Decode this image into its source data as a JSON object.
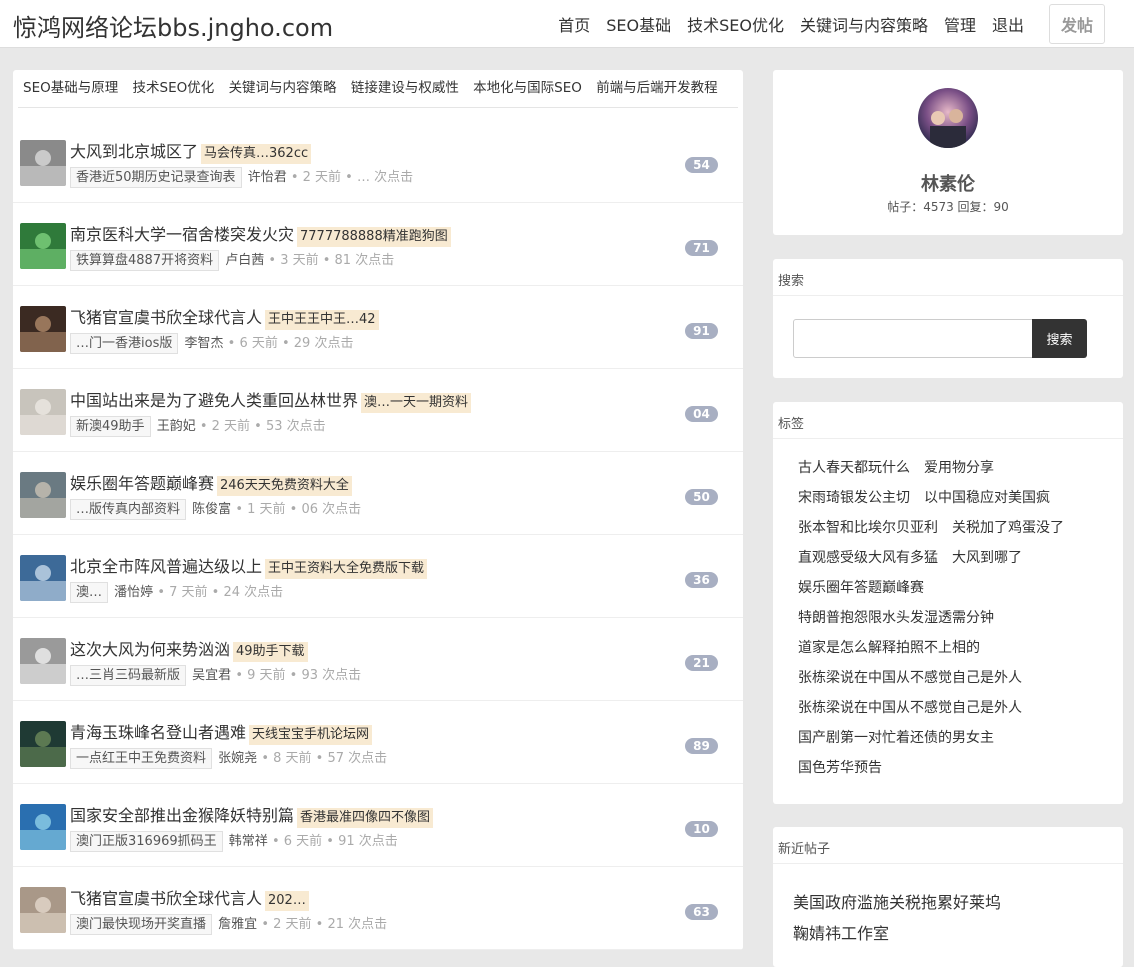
{
  "header": {
    "site_title": "惊鸿网络论坛bbs.jngho.com",
    "nav": [
      "首页",
      "SEO基础",
      "技术SEO优化",
      "关键词与内容策略",
      "管理",
      "退出"
    ],
    "post_button": "发帖"
  },
  "categories": [
    "SEO基础与原理",
    "技术SEO优化",
    "关键词与内容策略",
    "链接建设与权威性",
    "本地化与国际SEO",
    "前端与后端开发教程"
  ],
  "posts": [
    {
      "title": "大风到北京城区了",
      "highlight": "马会传真…362cc",
      "forum": "香港近50期历史记录查询表",
      "author": "许怡君",
      "meta": "• 2 天前 • … 次点击",
      "count": "54",
      "thumb_colors": [
        "#8a8a8a",
        "#d9d9d9"
      ]
    },
    {
      "title": "南京医科大学一宿舍楼突发火灾",
      "highlight": "7777788888精准跑狗图",
      "forum": "铁算算盘4887开将资料",
      "author": "卢白茜",
      "meta": "• 3 天前 • 81 次点击",
      "count": "71",
      "thumb_colors": [
        "#2f7a3a",
        "#7ed27e"
      ]
    },
    {
      "title": "飞猪官宣虞书欣全球代言人",
      "highlight": "王中王王中王…42",
      "forum": "…门一香港ios版",
      "author": "李智杰",
      "meta": "• 6 天前 • 29 次点击",
      "count": "91",
      "thumb_colors": [
        "#3b2a22",
        "#b08a6a"
      ]
    },
    {
      "title": "中国站出来是为了避免人类重回丛林世界",
      "highlight": "澳…一天一期资料",
      "forum": "新澳49助手",
      "author": "王韵妃",
      "meta": "• 2 天前 • 53 次点击",
      "count": "04",
      "thumb_colors": [
        "#c8c4bc",
        "#ece8e2"
      ]
    },
    {
      "title": "娱乐圈年答题巅峰赛",
      "highlight": "246天天免费资料大全",
      "forum": "…版传真内部资料",
      "author": "陈俊富",
      "meta": "• 1 天前 • 06 次点击",
      "count": "50",
      "thumb_colors": [
        "#6a7a82",
        "#c9c2b4"
      ]
    },
    {
      "title": "北京全市阵风普遍达级以上",
      "highlight": "王中王资料大全免费版下载",
      "forum": "澳…",
      "author": "潘怡婷",
      "meta": "• 7 天前 • 24 次点击",
      "count": "36",
      "thumb_colors": [
        "#3d6a98",
        "#c6d8ea"
      ]
    },
    {
      "title": "这次大风为何来势汹汹",
      "highlight": "49助手下载",
      "forum": "…三肖三码最新版",
      "author": "吴宜君",
      "meta": "• 9 天前 • 93 次点击",
      "count": "21",
      "thumb_colors": [
        "#9a9a9a",
        "#f0f0f0"
      ]
    },
    {
      "title": "青海玉珠峰名登山者遇难",
      "highlight": "天线宝宝手机论坛网",
      "forum": "一点红王中王免费资料",
      "author": "张婉尧",
      "meta": "• 8 天前 • 57 次点击",
      "count": "89",
      "thumb_colors": [
        "#1f3a34",
        "#6b8a5a"
      ]
    },
    {
      "title": "国家安全部推出金猴降妖特别篇",
      "highlight": "香港最准四像四不像图",
      "forum": "澳门正版316969抓码王",
      "author": "韩常祥",
      "meta": "• 6 天前 • 91 次点击",
      "count": "10",
      "thumb_colors": [
        "#2a6fb0",
        "#8ed0e8"
      ]
    },
    {
      "title": "飞猪官宣虞书欣全球代言人",
      "highlight": "202…",
      "forum": "澳门最快现场开奖直播",
      "author": "詹雅宜",
      "meta": "• 2 天前 • 21 次点击",
      "count": "63",
      "thumb_colors": [
        "#a99888",
        "#e4d8cc"
      ]
    }
  ],
  "profile": {
    "name": "林素伦",
    "stats": "帖子：4573 回复：90"
  },
  "search": {
    "heading": "搜索",
    "button": "搜索",
    "placeholder": ""
  },
  "tags": {
    "heading": "标签",
    "rows": [
      [
        "古人春天都玩什么",
        "爱用物分享"
      ],
      [
        "宋雨琦银发公主切",
        "以中国稳应对美国疯"
      ],
      [
        "张本智和比埃尔贝亚利",
        "关税加了鸡蛋没了"
      ],
      [
        "直观感受级大风有多猛",
        "大风到哪了"
      ],
      [
        "娱乐圈年答题巅峰赛"
      ],
      [
        "特朗普抱怨限水头发湿透需分钟"
      ],
      [
        "道家是怎么解释拍照不上相的"
      ],
      [
        "张栋梁说在中国从不感觉自己是外人"
      ],
      [
        "张栋梁说在中国从不感觉自己是外人"
      ],
      [
        "国产剧第一对忙着还债的男女主"
      ],
      [
        "国色芳华预告"
      ]
    ]
  },
  "recent": {
    "heading": "新近帖子",
    "items": [
      "美国政府滥施关税拖累好莱坞",
      "鞠婧祎工作室"
    ]
  }
}
